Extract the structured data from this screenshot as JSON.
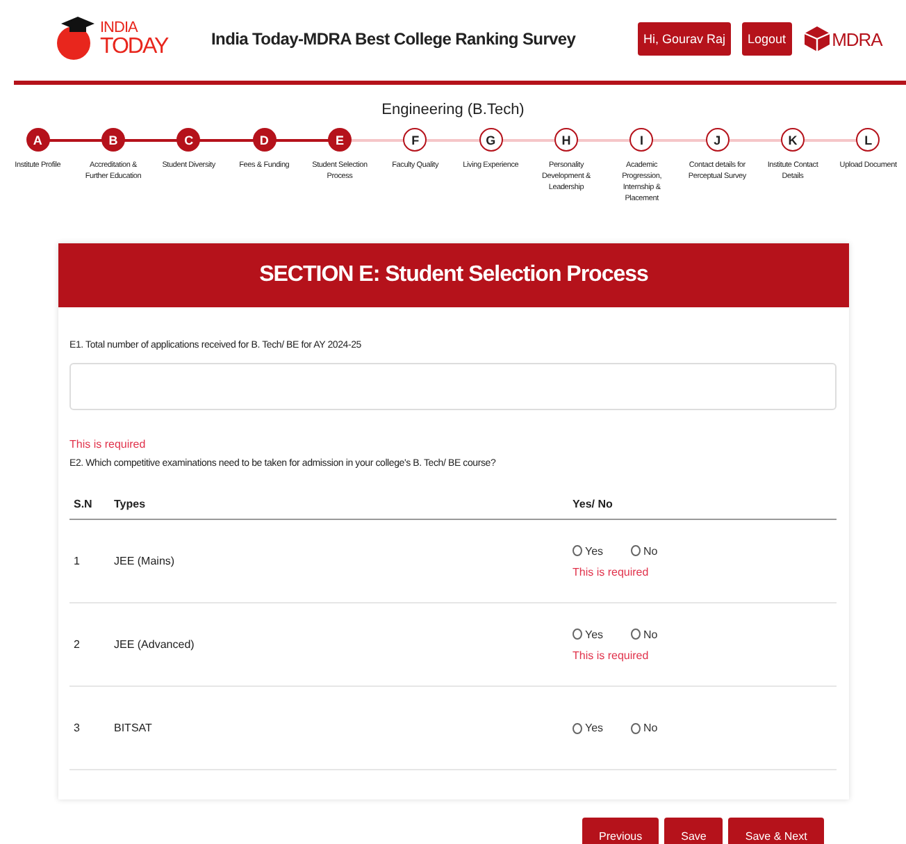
{
  "header": {
    "logo_line1": "INDIA",
    "logo_line2": "TODAY",
    "title": "India Today-MDRA Best College Ranking Survey",
    "user_button": "Hi, Gourav Raj",
    "logout_button": "Logout",
    "partner_logo": "MDRA"
  },
  "stream": "Engineering (B.Tech)",
  "steps": [
    {
      "letter": "A",
      "label": "Institute Profile",
      "completed": true
    },
    {
      "letter": "B",
      "label": "Accreditation & Further Education",
      "completed": true
    },
    {
      "letter": "C",
      "label": "Student Diversity",
      "completed": true
    },
    {
      "letter": "D",
      "label": "Fees & Funding",
      "completed": true
    },
    {
      "letter": "E",
      "label": "Student Selection Process",
      "completed": true
    },
    {
      "letter": "F",
      "label": "Faculty Quality",
      "completed": false
    },
    {
      "letter": "G",
      "label": "Living Experience",
      "completed": false
    },
    {
      "letter": "H",
      "label": "Personality Development & Leadership",
      "completed": false
    },
    {
      "letter": "I",
      "label": "Academic Progression, Internship & Placement",
      "completed": false
    },
    {
      "letter": "J",
      "label": "Contact details for Perceptual Survey",
      "completed": false
    },
    {
      "letter": "K",
      "label": "Institute Contact Details",
      "completed": false
    },
    {
      "letter": "L",
      "label": "Upload Document",
      "completed": false
    }
  ],
  "section_title": "SECTION E: Student Selection Process",
  "q1": {
    "label": "E1. Total number of applications received for B. Tech/ BE for AY 2024-25",
    "error": "This is required"
  },
  "q2": {
    "label": "E2. Which competitive examinations need to be taken for admission in your college's B. Tech/ BE course?",
    "columns": [
      "S.N",
      "Types",
      "Yes/ No"
    ],
    "rows": [
      {
        "sn": "1",
        "type": "JEE (Mains)",
        "options": [
          {
            "label": "Yes",
            "selected": false
          },
          {
            "label": "No",
            "selected": false
          }
        ],
        "error": "This is required"
      },
      {
        "sn": "2",
        "type": "JEE (Advanced)",
        "options": [
          {
            "label": "Yes",
            "selected": false
          },
          {
            "label": "No",
            "selected": false
          }
        ],
        "error": "This is required"
      },
      {
        "sn": "3",
        "type": "BITSAT",
        "options": [
          {
            "label": "Yes",
            "selected": false
          },
          {
            "label": "No",
            "selected": false
          }
        ]
      }
    ]
  },
  "buttons": [
    "Previous",
    "Save",
    "Save & Next"
  ]
}
